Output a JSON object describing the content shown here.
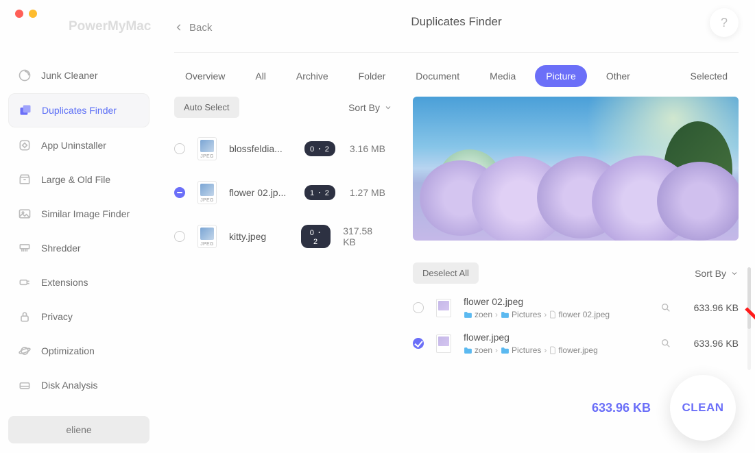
{
  "app": {
    "name": "PowerMyMac"
  },
  "header": {
    "back_label": "Back",
    "title": "Duplicates Finder",
    "help_label": "?"
  },
  "sidebar": {
    "items": [
      {
        "label": "Junk Cleaner",
        "icon": "broom"
      },
      {
        "label": "Duplicates Finder",
        "icon": "copy",
        "active": true
      },
      {
        "label": "App Uninstaller",
        "icon": "app"
      },
      {
        "label": "Large & Old File",
        "icon": "box"
      },
      {
        "label": "Similar Image Finder",
        "icon": "image"
      },
      {
        "label": "Shredder",
        "icon": "shredder"
      },
      {
        "label": "Extensions",
        "icon": "plugin"
      },
      {
        "label": "Privacy",
        "icon": "lock"
      },
      {
        "label": "Optimization",
        "icon": "planet"
      },
      {
        "label": "Disk Analysis",
        "icon": "disk"
      }
    ],
    "user": "eliene"
  },
  "tabs": [
    {
      "label": "Overview"
    },
    {
      "label": "All"
    },
    {
      "label": "Archive"
    },
    {
      "label": "Folder"
    },
    {
      "label": "Document"
    },
    {
      "label": "Media"
    },
    {
      "label": "Picture",
      "active": true
    },
    {
      "label": "Other"
    },
    {
      "label": "Selected"
    }
  ],
  "left": {
    "auto_select_label": "Auto Select",
    "sort_by_label": "Sort By",
    "files": [
      {
        "name": "blossfeldia...",
        "badge": "0 ･ 2",
        "size": "3.16 MB",
        "state": "none",
        "thumb_label": "JPEG"
      },
      {
        "name": "flower 02.jp...",
        "badge": "1 ･ 2",
        "size": "1.27 MB",
        "state": "indeterminate",
        "thumb_label": "JPEG"
      },
      {
        "name": "kitty.jpeg",
        "badge": "0 ･ 2",
        "size": "317.58 KB",
        "state": "none",
        "thumb_label": "JPEG"
      }
    ]
  },
  "right": {
    "deselect_all_label": "Deselect All",
    "sort_by_label": "Sort By",
    "duplicates": [
      {
        "name": "flower 02.jpeg",
        "size": "633.96 KB",
        "state": "none",
        "path": [
          {
            "type": "folder",
            "label": "zoen"
          },
          {
            "type": "folder",
            "label": "Pictures"
          },
          {
            "type": "file",
            "label": "flower 02.jpeg"
          }
        ]
      },
      {
        "name": "flower.jpeg",
        "size": "633.96 KB",
        "state": "checked",
        "path": [
          {
            "type": "folder",
            "label": "zoen"
          },
          {
            "type": "folder",
            "label": "Pictures"
          },
          {
            "type": "file",
            "label": "flower.jpeg"
          }
        ]
      }
    ]
  },
  "footer": {
    "total_size": "633.96 KB",
    "clean_label": "CLEAN"
  }
}
